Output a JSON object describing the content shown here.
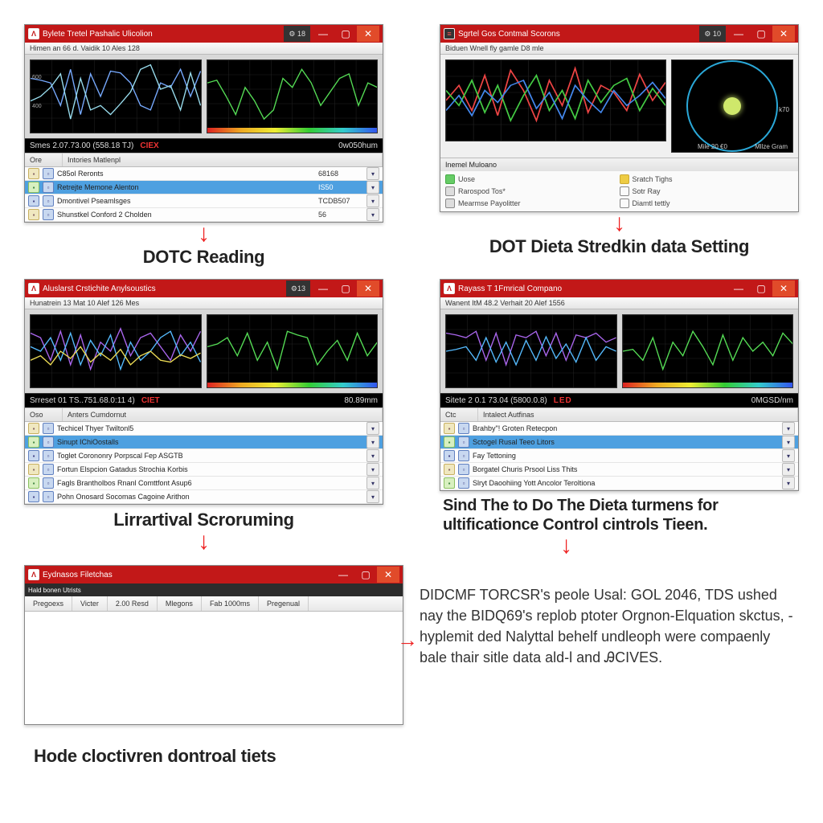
{
  "panelA": {
    "title": "Bylete Tretel Pashalic Ulicolion",
    "menu": "Himen an 66 d. Vaidik 10 Ales 128",
    "status_left": "Smes 2.07.73.00 (558.18 TJ)",
    "status_mode": "CIEX",
    "status_right": "0w050hum",
    "head_col1": "Ore",
    "head_col2": "Intories Matlenpl",
    "rows": [
      {
        "label": "C85ol Reronts",
        "val": "68168"
      },
      {
        "label": "Retrejte Memone Alenton",
        "val": "IS50",
        "sel": true
      },
      {
        "label": "Dmontivel Pseamlsges",
        "val": "TCDB507"
      },
      {
        "label": "Shunstkel Conford 2 Cholden",
        "val": "56"
      }
    ],
    "caption": "DOTC Reading"
  },
  "panelB": {
    "title": "Sgrtel Gos Contmal Scorons",
    "menu": "Biduen Wnell fly gamle D8 mle",
    "dial_side": "k70",
    "dial_l": "Mile 20 €0",
    "dial_r": "Mllze Gram",
    "opts_head": "Inemel Muloano",
    "opts": [
      {
        "label": "Uose",
        "cls": "green"
      },
      {
        "label": "Sratch Tighs",
        "cls": "yel"
      },
      {
        "label": "Rarospod Tos*",
        "cls": "gray"
      },
      {
        "label": "Sotr Ray",
        "cls": ""
      },
      {
        "label": "Mearmse Payolitter",
        "cls": "gray"
      },
      {
        "label": "Diamtl tettly",
        "cls": ""
      }
    ],
    "caption": "DOT Dieta Stredkin data Setting"
  },
  "panelC": {
    "title": "Aluslarst Crstichite Anylsoustics",
    "menu": "Hunatrein 13 Mat 10 Alef 126 Mes",
    "badge": "13",
    "status_left": "Srreset 01 TS..751.68.0:11 4)",
    "status_mode": "CIET",
    "status_right": "80.89mm",
    "head_col1": "Oso",
    "head_col2": "Anters Cumdornut",
    "rows": [
      {
        "label": "Techicel Thyer Twiltonl5"
      },
      {
        "label": "Sinupt IChiOostalls",
        "sel": true
      },
      {
        "label": "Toglet Corononry Porpscal Fep ASGTB"
      },
      {
        "label": "Fortun Elspcion Gatadus Strochia Korbis"
      },
      {
        "label": "Fagls Brantholbos Rnanl Comttfont Asup6"
      },
      {
        "label": "Pohn Onosard Socomas Cagoine Arithon"
      }
    ],
    "caption": "Lirrartival Scroruming"
  },
  "panelD": {
    "title": "Rayass T 1Fmrical Compano",
    "menu": "Wanent ItM 48.2  Verhait 20 Alef 1556",
    "status_left": "Sitete 2 0.1 73.04 (5800.0.8)",
    "status_mode": "LED",
    "status_right": "0MGSD/nm",
    "head_col1": "Ctc",
    "head_col2": "Intalect Autfinas",
    "rows": [
      {
        "label": "Brahby\"! Groten Retecpon"
      },
      {
        "label": "Sctogel Rusal Teeo Litors",
        "sel": true
      },
      {
        "label": "Fay Tettoning"
      },
      {
        "label": "Borgatel Churis Prsool Liss Thits"
      },
      {
        "label": "Slryt Daoohiing Yott Ancolor Teroltiona"
      }
    ],
    "caption": "Sind The to Do The Dieta turmens for ultificationce Control cintrols Tieen."
  },
  "panelE": {
    "title": "Eydnasos Filetchas",
    "menu": "Hald bonen Utrists",
    "tabs": [
      "Pregoexs",
      "Victer",
      "2.00 Resd",
      "Mlegons",
      "Fab 1000ms",
      "Pregenual"
    ],
    "caption": "Hode cloctivren dontroal tiets"
  },
  "paragraph": "DIDCMF TORCSR's peole Usal: GOL 2046, TDS ushed nay the BIDQ69's replob ptoter Orgnon-Elquation skctus, -hyplemit ded Nalyttal behelf undleoph were compaenly bale thair sitle data ald-l and ᎯCIVES.",
  "chart_data": [
    {
      "id": "A-left",
      "type": "line",
      "series": [
        {
          "name": "c1",
          "color": "#7af",
          "values": [
            60,
            58,
            55,
            30,
            70,
            20,
            65,
            40,
            68,
            66,
            55,
            30,
            25,
            55,
            50,
            70,
            40,
            68
          ]
        },
        {
          "name": "c2",
          "color": "#9de",
          "values": [
            35,
            40,
            50,
            65,
            15,
            60,
            25,
            30,
            20,
            32,
            45,
            70,
            75,
            48,
            52,
            25,
            66,
            30
          ]
        }
      ],
      "yticks": [
        400,
        600
      ],
      "bg": "#000"
    },
    {
      "id": "A-right",
      "type": "line",
      "series": [
        {
          "name": "g",
          "color": "#5d5",
          "values": [
            55,
            58,
            40,
            20,
            50,
            35,
            15,
            25,
            60,
            50,
            70,
            55,
            30,
            45,
            60,
            65,
            30,
            55,
            50
          ]
        }
      ],
      "rainbow": true,
      "bg": "#000"
    },
    {
      "id": "B-left",
      "type": "line",
      "series": [
        {
          "name": "r",
          "color": "#e44",
          "values": [
            40,
            55,
            30,
            65,
            25,
            70,
            50,
            20,
            60,
            35,
            72,
            28,
            55,
            48,
            30,
            66,
            40,
            58
          ]
        },
        {
          "name": "g",
          "color": "#4c4",
          "values": [
            50,
            35,
            60,
            28,
            55,
            20,
            45,
            65,
            30,
            50,
            22,
            60,
            38,
            55,
            62,
            30,
            52,
            35
          ]
        },
        {
          "name": "b",
          "color": "#48e",
          "values": [
            30,
            45,
            25,
            50,
            38,
            55,
            60,
            32,
            48,
            22,
            55,
            40,
            28,
            50,
            35,
            45,
            58,
            42
          ]
        }
      ],
      "bg": "#000"
    },
    {
      "id": "C-left",
      "type": "line",
      "series": [
        {
          "name": "p",
          "color": "#a6e",
          "values": [
            60,
            55,
            30,
            62,
            25,
            58,
            20,
            50,
            40,
            65,
            35,
            55,
            60,
            45,
            30,
            58,
            40,
            62
          ]
        },
        {
          "name": "b",
          "color": "#5bf",
          "values": [
            45,
            40,
            55,
            30,
            60,
            25,
            52,
            35,
            58,
            20,
            50,
            30,
            40,
            55,
            62,
            35,
            50,
            28
          ]
        },
        {
          "name": "y",
          "color": "#ed5",
          "values": [
            30,
            35,
            25,
            40,
            32,
            45,
            28,
            38,
            30,
            42,
            25,
            35,
            40,
            30,
            28,
            36,
            32,
            38
          ]
        }
      ],
      "bg": "#000"
    },
    {
      "id": "C-right",
      "type": "line",
      "series": [
        {
          "name": "g",
          "color": "#5d5",
          "values": [
            45,
            48,
            55,
            35,
            60,
            30,
            50,
            20,
            62,
            58,
            55,
            25,
            40,
            52,
            30,
            60,
            35,
            50
          ]
        }
      ],
      "rainbow": true,
      "bg": "#000"
    },
    {
      "id": "D-left",
      "type": "line",
      "series": [
        {
          "name": "p",
          "color": "#a6e",
          "values": [
            60,
            58,
            55,
            62,
            30,
            60,
            25,
            58,
            55,
            62,
            35,
            60,
            30,
            58,
            55,
            60,
            50,
            55
          ]
        },
        {
          "name": "b",
          "color": "#5bf",
          "values": [
            40,
            42,
            45,
            30,
            55,
            28,
            50,
            25,
            52,
            30,
            56,
            32,
            48,
            28,
            55,
            30,
            45,
            40
          ]
        }
      ],
      "bg": "#000"
    },
    {
      "id": "D-right",
      "type": "line",
      "series": [
        {
          "name": "g",
          "color": "#5d5",
          "values": [
            40,
            42,
            30,
            55,
            20,
            50,
            35,
            62,
            45,
            25,
            58,
            30,
            55,
            40,
            50,
            35,
            60,
            48
          ]
        }
      ],
      "rainbow": true,
      "bg": "#000"
    }
  ]
}
